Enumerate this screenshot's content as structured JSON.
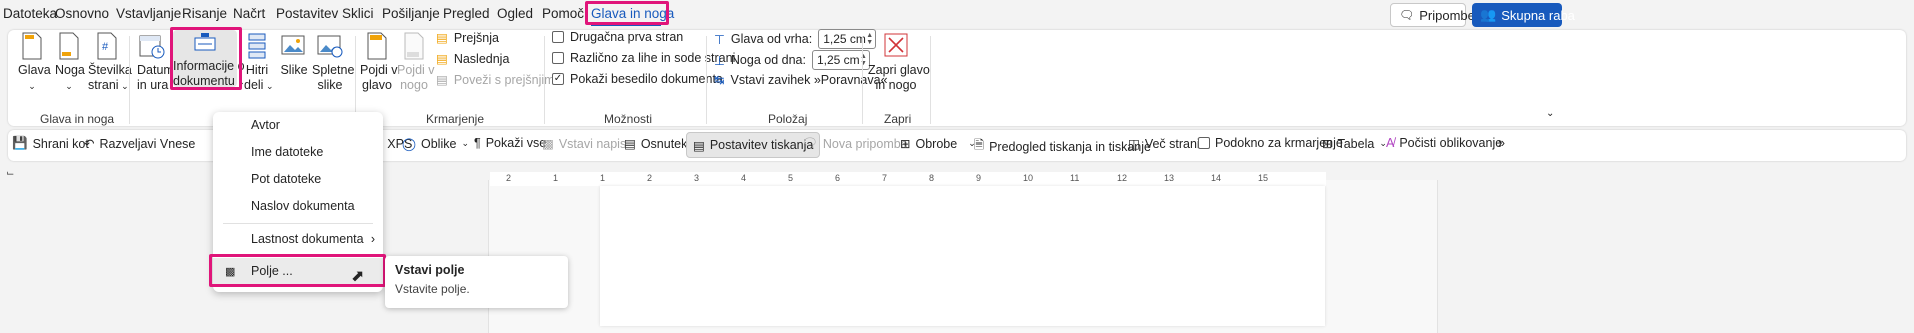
{
  "menu": {
    "tabs": [
      "Datoteka",
      "Osnovno",
      "Vstavljanje",
      "Risanje",
      "Načrt",
      "Postavitev",
      "Sklici",
      "Pošiljanje",
      "Pregled",
      "Ogled",
      "Pomoč",
      "Glava in noga"
    ],
    "comments_label": "Pripombe",
    "share_label": "Skupna raba"
  },
  "ribbon": {
    "glava": "Glava",
    "noga": "Noga",
    "stevilka": "Številka",
    "strani": "strani",
    "group_glava_in_noga": "Glava in noga",
    "datum": "Datum",
    "in_ura": "in ura",
    "informacije": "Informacije o",
    "dokumentu": "dokumentu",
    "hitri": "Hitri",
    "deli": "deli",
    "slike": "Slike",
    "spletne": "Spletne",
    "slike2": "slike",
    "pojdi_v_glavo_1": "Pojdi v",
    "pojdi_v_glavo_2": "glavo",
    "pojdi_v_nogo_1": "Pojdi v",
    "pojdi_v_nogo_2": "nogo",
    "prejsnja": "Prejšnja",
    "naslednja": "Naslednja",
    "povezi": "Poveži s prejšnjim",
    "group_krmarjenje": "Krmarjenje",
    "druga_prva": "Drugačna prva stran",
    "razlicno": "Različno za lihe in sode strani",
    "pokazi_besedilo": "Pokaži besedilo dokumenta",
    "group_moznosti": "Možnosti",
    "glava_od_vrha": "Glava od vrha:",
    "glava_value": "1,25 cm",
    "noga_od_dna": "Noga od dna:",
    "noga_value": "1,25 cm",
    "vstavi_zavihek": "Vstavi zavihek »Poravnava«",
    "group_polozaj": "Položaj",
    "zapri_1": "Zapri glavo",
    "zapri_2": "in nogo",
    "group_zapri": "Zapri"
  },
  "qat": {
    "shrani": "Shrani kot",
    "razveljavi": "Razveljavi Vnese",
    "pdf": "PDF ali XPS",
    "oblike": "Oblike",
    "pokazi_vse": "Pokaži vse",
    "vstavi_napis": "Vstavi napis",
    "osnutek": "Osnutek",
    "postavitev": "Postavitev tiskanja",
    "nova_pripomba": "Nova pripomba",
    "obrobe": "Obrobe",
    "predogled": "Predogled tiskanja in tiskanje",
    "vec_strani": "Več strani",
    "podokno": "Podokno za krmarjenje",
    "tabela": "Tabela",
    "pocisti": "Počisti oblikovanje",
    "more": "»"
  },
  "ruler_numbers": [
    "2",
    "1",
    "1",
    "2",
    "3",
    "4",
    "5",
    "6",
    "7",
    "8",
    "9",
    "10",
    "11",
    "12",
    "13",
    "14",
    "15"
  ],
  "dropdown": {
    "items": [
      "Avtor",
      "Ime datoteke",
      "Pot datoteke",
      "Naslov dokumenta",
      "Lastnost dokumenta",
      "Polje ..."
    ]
  },
  "tooltip": {
    "title": "Vstavi polje",
    "desc": "Vstavite polje."
  },
  "colors": {
    "accent": "#185abd",
    "highlight": "#e0157a"
  }
}
